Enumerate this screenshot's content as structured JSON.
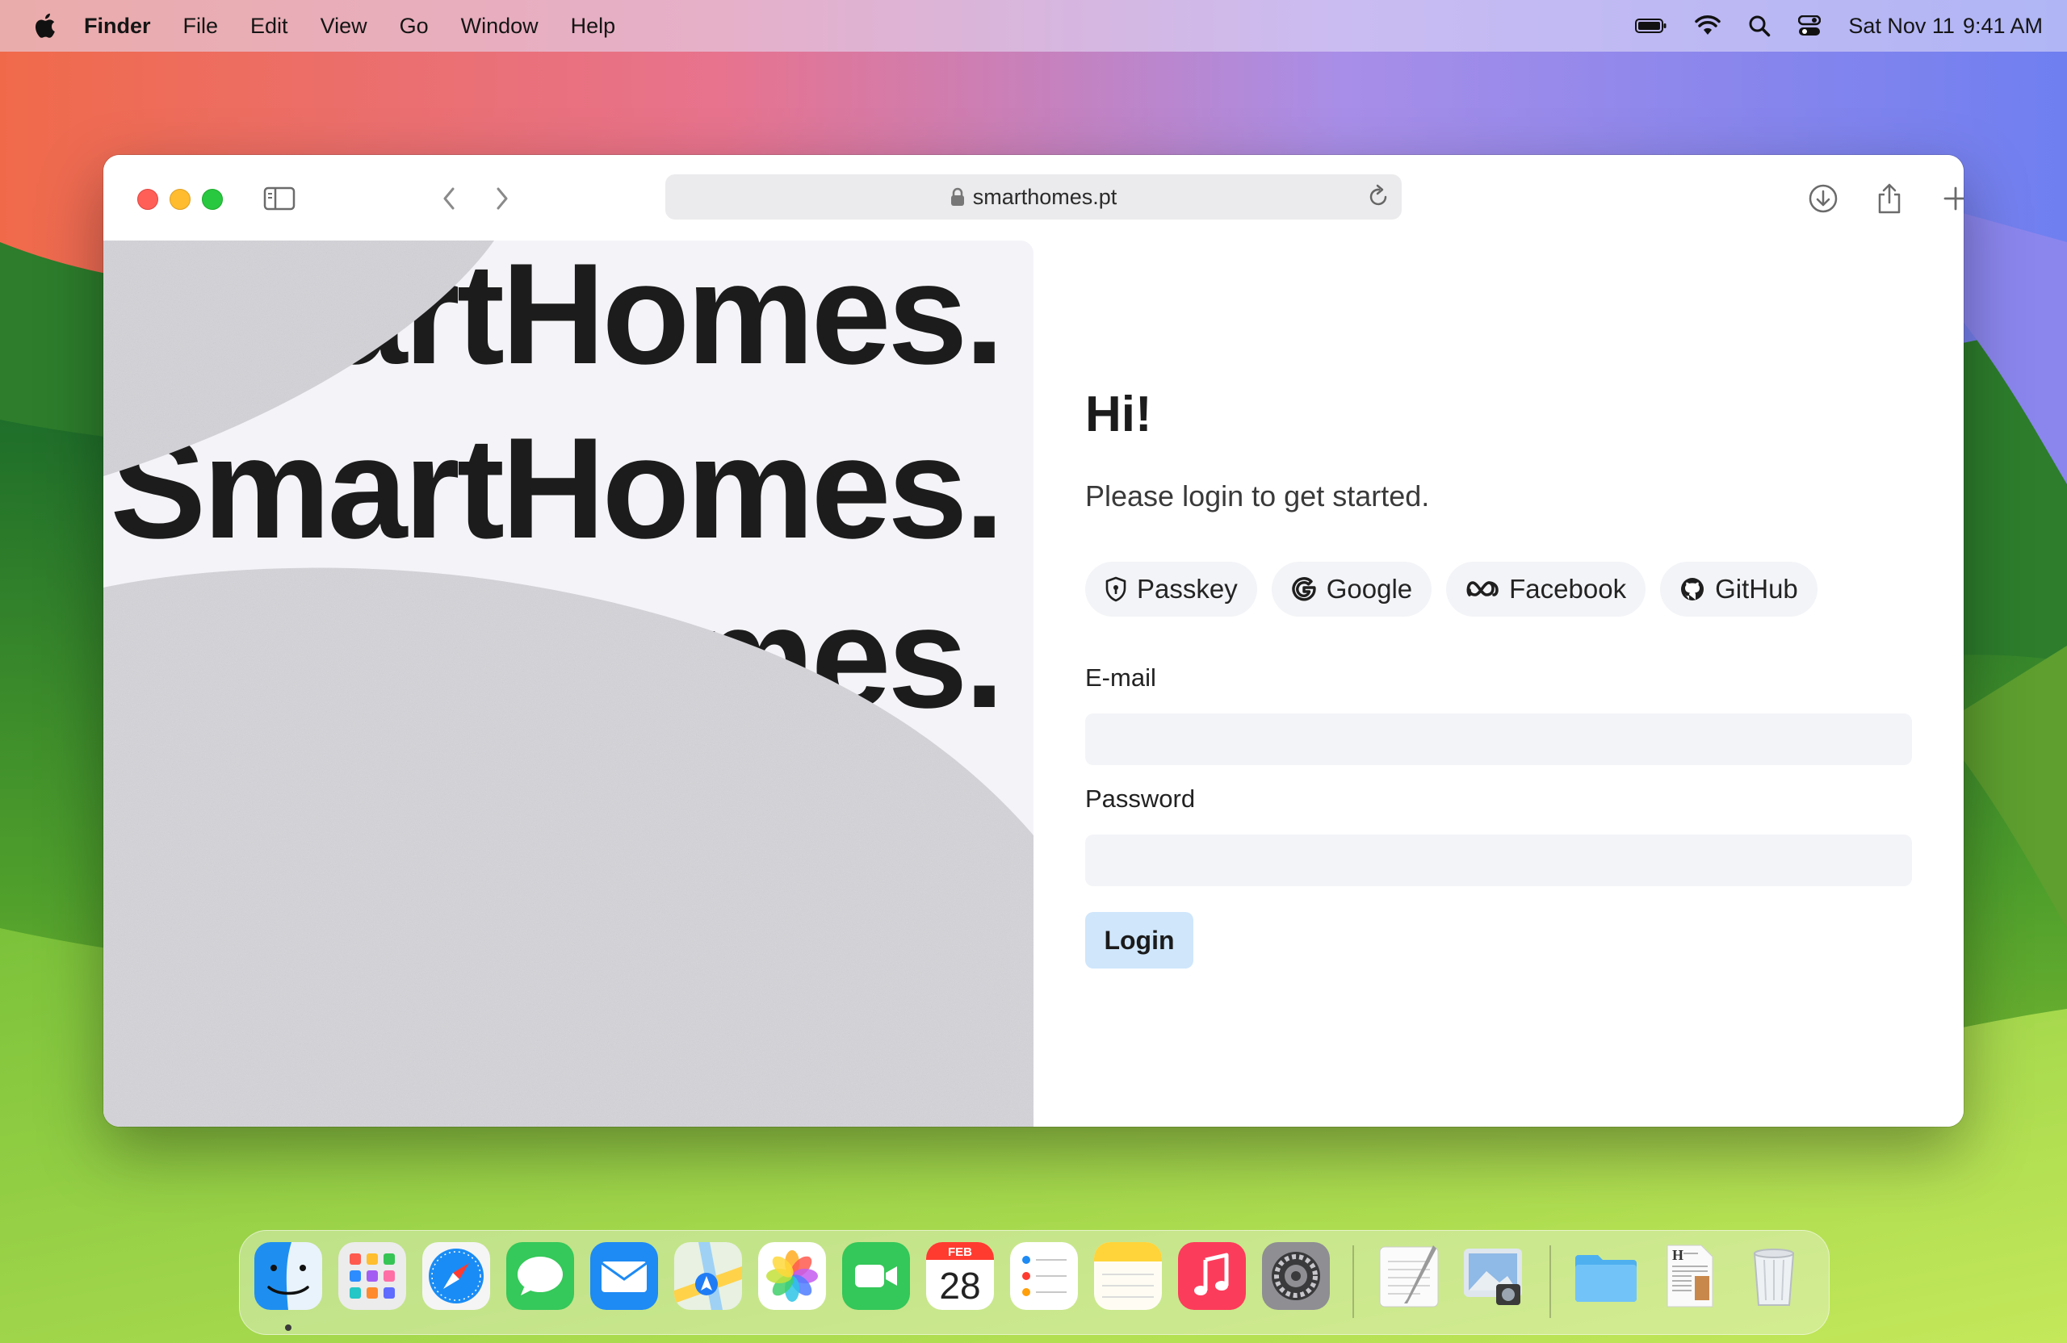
{
  "menubar": {
    "apple_icon": "apple-logo-icon",
    "app_name": "Finder",
    "items": [
      "File",
      "Edit",
      "View",
      "Go",
      "Window",
      "Help"
    ],
    "status_icons": [
      "battery-icon",
      "wifi-icon",
      "spotlight-search-icon",
      "control-center-icon"
    ],
    "date": "Sat Nov 11",
    "time": "9:41 AM"
  },
  "browser": {
    "url": "smarthomes.pt",
    "toolbar_icons": [
      "sidebar-icon",
      "back-icon",
      "forward-icon",
      "privacy-shield-icon",
      "lock-icon",
      "reload-icon",
      "download-icon",
      "share-icon",
      "new-tab-icon",
      "tab-overview-icon"
    ]
  },
  "hero": {
    "lines": [
      "SmartHomes.",
      "SmartHomes.",
      "SmartHomes."
    ]
  },
  "login": {
    "title": "Hi!",
    "subtitle": "Please login to get started.",
    "providers": [
      {
        "label": "Passkey",
        "icon": "passkey-shield-icon"
      },
      {
        "label": "Google",
        "icon": "google-icon"
      },
      {
        "label": "Facebook",
        "icon": "meta-icon"
      },
      {
        "label": "GitHub",
        "icon": "github-icon"
      }
    ],
    "email_label": "E-mail",
    "email_value": "",
    "password_label": "Password",
    "password_value": "",
    "submit_label": "Login"
  },
  "dock": {
    "apps": [
      "Finder",
      "Launchpad",
      "Safari",
      "Messages",
      "Mail",
      "Maps",
      "Photos",
      "FaceTime",
      "Calendar",
      "Reminders",
      "Notes",
      "Music",
      "System Settings",
      "TextEdit",
      "Preview",
      "Downloads",
      "Document",
      "Trash"
    ],
    "calendar_month": "FEB",
    "calendar_day": "28"
  }
}
